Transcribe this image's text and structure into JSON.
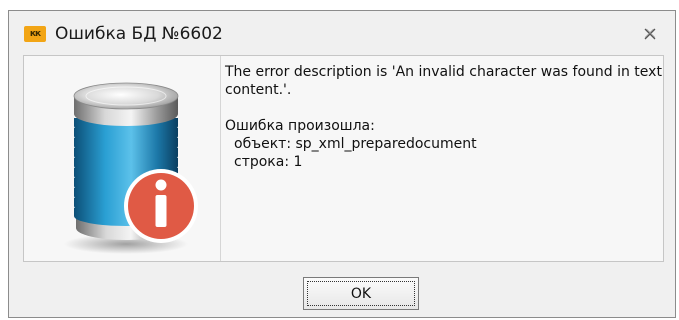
{
  "window": {
    "title": "Ошибка БД №6602",
    "app_icon_text": "кк"
  },
  "message": {
    "line1": "The error description is 'An invalid character was found in text",
    "line2": "content.'.",
    "error_heading": "Ошибка произошла:",
    "object_line": "объект: sp_xml_preparedocument",
    "row_line": "строка: 1"
  },
  "buttons": {
    "ok_label": "OK"
  },
  "icons": {
    "app": "app-logo-icon",
    "close": "close-icon",
    "main": "database-info-icon",
    "badge": "info-icon"
  },
  "colors": {
    "info_badge": "#e05a45",
    "database_body": "#1f7fb0",
    "app_icon": "#f2a515"
  }
}
